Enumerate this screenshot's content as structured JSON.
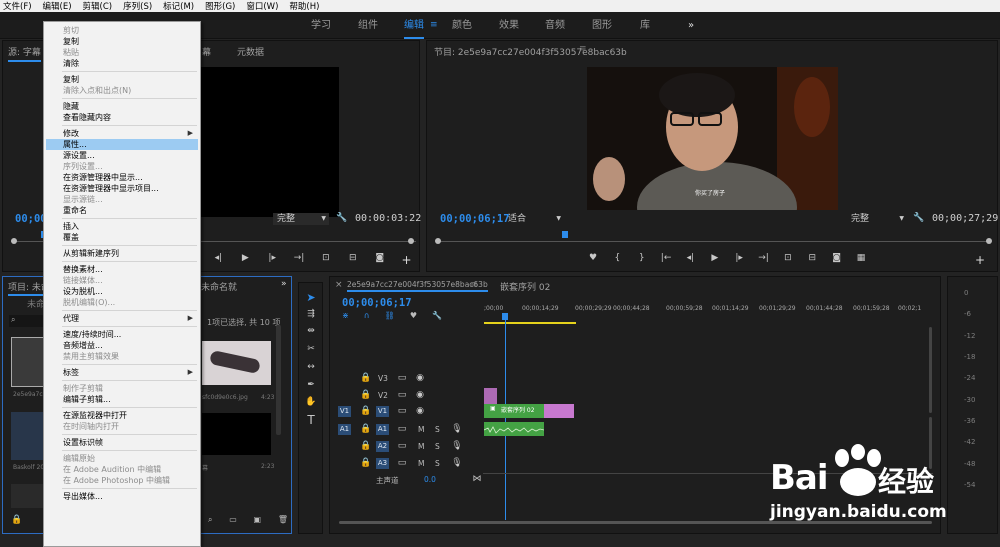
{
  "menubar": [
    "文件(F)",
    "编辑(E)",
    "剪辑(C)",
    "序列(S)",
    "标记(M)",
    "图形(G)",
    "窗口(W)",
    "帮助(H)"
  ],
  "workspaces": {
    "tabs": [
      "学习",
      "组件",
      "编辑",
      "颜色",
      "效果",
      "音频",
      "图形",
      "库"
    ],
    "active": "编辑",
    "overflow": "»"
  },
  "source_panel": {
    "title": "源: 字幕",
    "tab2": "幕",
    "tab3": "元数据",
    "timecode_left": "00;00:",
    "fit": "完整",
    "timecode_right": "00:00:03:22"
  },
  "program_panel": {
    "title": "节目: 2e5e9a7cc27e004f3f53057e8bac63b",
    "timecode": "00;00;06;17",
    "fit": "适合",
    "quality": "完整",
    "duration": "00;00;27;29",
    "subtitle": "你买了房子"
  },
  "project_panel": {
    "title": "项目: 未命",
    "tab2": "未命名就",
    "sub_item": "未命",
    "selection_status": "1项已选择, 共 10 项",
    "items": [
      {
        "name": "2e5e9a7cc2",
        "duration": ""
      },
      {
        "name": "Baskolf 202",
        "duration": ""
      },
      {
        "name": "sfc0d9e0c6.jpg",
        "duration": "4:23"
      },
      {
        "name": "幕",
        "duration": "2:23"
      }
    ]
  },
  "context_menu": {
    "items": [
      {
        "label": "剪切",
        "disabled": true
      },
      {
        "label": "复制"
      },
      {
        "label": "粘贴",
        "disabled": true
      },
      {
        "label": "清除"
      },
      {
        "label": "复制"
      },
      {
        "label": "清除入点和出点(N)",
        "disabled": true
      },
      {
        "label": "隐藏"
      },
      {
        "label": "查看隐藏内容"
      },
      {
        "label": "修改",
        "submenu": true
      },
      {
        "label": "属性...",
        "highlight": true
      },
      {
        "label": "源设置..."
      },
      {
        "label": "序列设置...",
        "disabled": true
      },
      {
        "label": "在资源管理器中显示..."
      },
      {
        "label": "在资源管理器中显示项目..."
      },
      {
        "label": "显示源链...",
        "disabled": true
      },
      {
        "label": "重命名"
      },
      {
        "label": "插入"
      },
      {
        "label": "覆盖"
      },
      {
        "label": "从剪辑新建序列"
      },
      {
        "label": "替换素材..."
      },
      {
        "label": "链接媒体...",
        "disabled": true
      },
      {
        "label": "设为脱机..."
      },
      {
        "label": "脱机编辑(O)...",
        "disabled": true
      },
      {
        "label": "代理",
        "submenu": true
      },
      {
        "label": "速度/持续时间..."
      },
      {
        "label": "音频增益..."
      },
      {
        "label": "禁用主剪辑效果",
        "disabled": true
      },
      {
        "label": "标签",
        "submenu": true
      },
      {
        "label": "制作子剪辑",
        "disabled": true
      },
      {
        "label": "编辑子剪辑..."
      },
      {
        "label": "在源监视器中打开"
      },
      {
        "label": "在时间轴内打开",
        "disabled": true
      },
      {
        "label": "设置标识帧"
      },
      {
        "label": "编辑原始",
        "disabled": true
      },
      {
        "label": "在 Adobe Audition 中编辑",
        "disabled": true
      },
      {
        "label": "在 Adobe Photoshop 中编辑",
        "disabled": true
      },
      {
        "label": "导出媒体..."
      }
    ]
  },
  "timeline": {
    "tab1": "2e5e9a7cc27e004f3f53057e8bac63b",
    "tab2": "嵌套序列 02",
    "timecode": "00;00;06;17",
    "ruler": [
      ";00;00",
      "00;00;14;29",
      "00;00;29;29",
      "00;00;44;28",
      "00;00;59;28",
      "00;01;14;29",
      "00;01;29;29",
      "00;01;44;28",
      "00;01;59;28",
      "00;02;1"
    ],
    "video_tracks": [
      "V3",
      "V2",
      "V1"
    ],
    "audio_tracks": [
      "A1",
      "A2",
      "A3"
    ],
    "source_v": "V1",
    "source_a": "A1",
    "master_label": "主声道",
    "master_value": "0.0",
    "clip_name": "嵌套序列 02",
    "mute": "M",
    "solo": "S"
  },
  "meter_scale": [
    "0",
    "-6",
    "-12",
    "-18",
    "-24",
    "-30",
    "-36",
    "-42",
    "-48",
    "-54"
  ],
  "watermark": {
    "brand": "Bai",
    "brand2": "经验",
    "url": "jingyan.baidu.com"
  },
  "icons": [
    "play-icon",
    "step-back-icon",
    "step-forward-icon",
    "wrench-icon",
    "camera-icon",
    "add-icon",
    "selection-tool-icon",
    "razor-tool-icon",
    "hand-tool-icon",
    "type-tool-icon",
    "eye-icon",
    "lock-icon",
    "mic-icon",
    "search-icon",
    "folder-icon",
    "trash-icon"
  ]
}
